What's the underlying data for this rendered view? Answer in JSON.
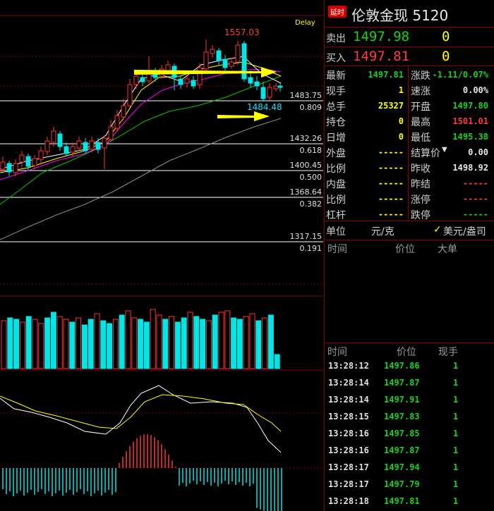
{
  "chart": {
    "delay_label": "Delay",
    "high_label": "1557.03",
    "low_label": "1484.48",
    "fib_levels": [
      {
        "price": "1483.75",
        "ratio": "0.809"
      },
      {
        "price": "1432.26",
        "ratio": "0.618"
      },
      {
        "price": "1400.45",
        "ratio": "0.500"
      },
      {
        "price": "1368.64",
        "ratio": "0.382"
      },
      {
        "price": "1317.15",
        "ratio": "0.191"
      }
    ],
    "colors": {
      "up": "#ff3333",
      "down": "#00e5e5",
      "ma5": "#ffffff",
      "ma10": "#ffff00",
      "ma20": "#ff00ff",
      "ma60": "#00cc00",
      "ma120": "#999999",
      "arrow": "#ffff00"
    }
  },
  "panel": {
    "delay_tag": "延时",
    "title": "伦敦金现",
    "code": "5120",
    "sell_label": "卖出",
    "sell_price": "1497.98",
    "sell_vol": "0",
    "buy_label": "买入",
    "buy_price": "1497.81",
    "buy_vol": "0",
    "stats_left": [
      {
        "label": "最新",
        "value": "1497.81",
        "color": "green"
      },
      {
        "label": "现手",
        "value": "1",
        "color": "yellow"
      },
      {
        "label": "总手",
        "value": "25327",
        "color": "yellow"
      },
      {
        "label": "持仓",
        "value": "0",
        "color": "yellow"
      },
      {
        "label": "日增",
        "value": "0",
        "color": "yellow"
      },
      {
        "label": "外盘",
        "value": "-----",
        "color": "yellow"
      },
      {
        "label": "比例",
        "value": "-----",
        "color": "yellow"
      },
      {
        "label": "内盘",
        "value": "-----",
        "color": "yellow"
      },
      {
        "label": "比例",
        "value": "-----",
        "color": "yellow"
      },
      {
        "label": "杠杆",
        "value": "-----",
        "color": "yellow"
      }
    ],
    "stats_right": [
      {
        "label": "涨跌",
        "value": "-1.11/0.07%",
        "color": "green"
      },
      {
        "label": "速涨",
        "value": "0.00%",
        "color": "white"
      },
      {
        "label": "开盘",
        "value": "1497.80",
        "color": "green"
      },
      {
        "label": "最高",
        "value": "1501.01",
        "color": "red"
      },
      {
        "label": "最低",
        "value": "1495.38",
        "color": "green"
      },
      {
        "label": "结算价",
        "value": "0.00",
        "color": "white"
      },
      {
        "label": "昨收",
        "value": "1498.92",
        "color": "white"
      },
      {
        "label": "昨结",
        "value": "-----",
        "color": "red"
      },
      {
        "label": "涨停",
        "value": "-----",
        "color": "red"
      },
      {
        "label": "跌停",
        "value": "-----",
        "color": "green"
      }
    ],
    "unit_label": "单位",
    "unit_cny": "元/克",
    "unit_usd": "美元/盎司",
    "big_header": {
      "time": "时间",
      "price": "价位",
      "big": "大单"
    },
    "tick_header": {
      "time": "时间",
      "price": "价位",
      "vol": "现手"
    },
    "ticks": [
      {
        "time": "13:28:12",
        "price": "1497.86",
        "vol": "1"
      },
      {
        "time": "13:28:14",
        "price": "1497.87",
        "vol": "1"
      },
      {
        "time": "13:28:14",
        "price": "1497.91",
        "vol": "1"
      },
      {
        "time": "13:28:15",
        "price": "1497.83",
        "vol": "1"
      },
      {
        "time": "13:28:16",
        "price": "1497.85",
        "vol": "1"
      },
      {
        "time": "13:28:16",
        "price": "1497.87",
        "vol": "1"
      },
      {
        "time": "13:28:17",
        "price": "1497.94",
        "vol": "1"
      },
      {
        "time": "13:28:17",
        "price": "1497.79",
        "vol": "1"
      },
      {
        "time": "13:28:18",
        "price": "1497.81",
        "vol": "1"
      }
    ]
  }
}
